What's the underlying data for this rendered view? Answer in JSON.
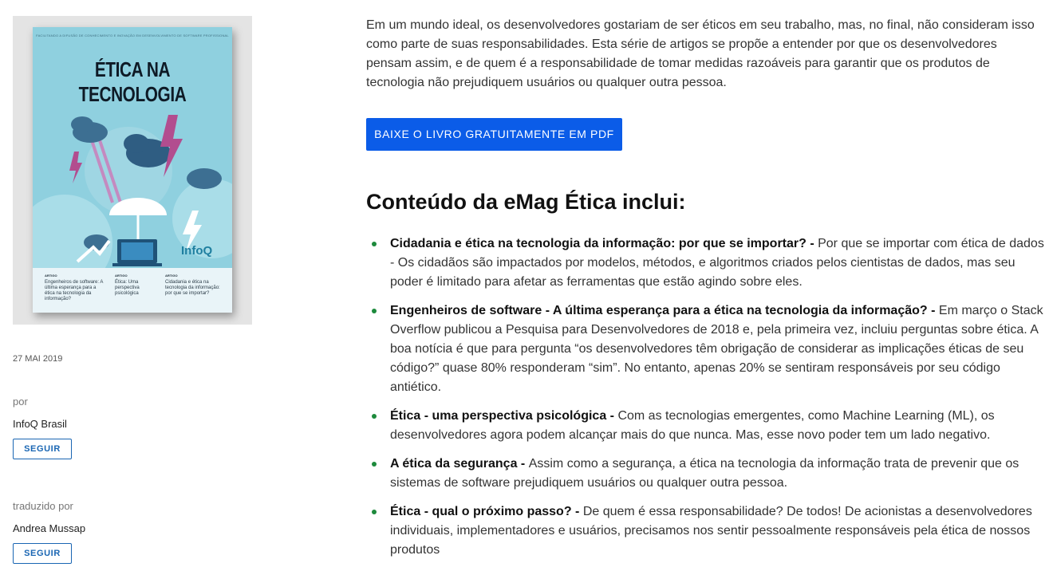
{
  "cover": {
    "top_strip": "FACILITANDO A DIFUSÃO DE CONHECIMENTO E INOVAÇÃO EM DESENVOLVIMENTO DE SOFTWARE PROFISSIONAL",
    "title": "ÉTICA NA TECNOLOGIA",
    "brand": "InfoQ",
    "articles": [
      {
        "tag": "ARTIGO",
        "text": "Engenheiros de software: A última esperança para a ética na tecnologia da informação?"
      },
      {
        "tag": "ARTIGO",
        "text": "Ética: Uma perspectiva psicológica"
      },
      {
        "tag": "ARTIGO",
        "text": "Cidadania e ética na tecnologia da informação: por que se importar?"
      }
    ]
  },
  "meta": {
    "date": "27 MAI 2019",
    "by_label": "por",
    "author": "InfoQ Brasil",
    "follow_label": "SEGUIR",
    "translated_label": "traduzido por",
    "translator": "Andrea Mussap"
  },
  "main": {
    "intro": "Em um mundo ideal, os desenvolvedores gostariam de ser éticos em seu trabalho, mas, no final, não consideram isso como parte de suas responsabilidades. Esta série de artigos se propõe a entender por que os desenvolvedores pensam assim, e de quem é a responsabilidade de tomar medidas razoáveis para garantir que os produtos de tecnologia não prejudiquem usuários ou qualquer outra pessoa.",
    "pdf_button": "BAIXE O LIVRO GRATUITAMENTE EM PDF",
    "section_title": "Conteúdo da eMag Ética inclui:",
    "items": [
      {
        "title": "Cidadania e ética na tecnologia da informação: por que se importar? - ",
        "text": "Por que se importar com ética de dados - Os cidadãos são impactados por modelos, métodos, e algoritmos criados pelos cientistas de dados, mas seu poder é limitado para afetar as ferramentas que estão agindo sobre eles."
      },
      {
        "title": "Engenheiros de software - A última esperança para a ética na tecnologia da informação? - ",
        "text": "Em março o Stack Overflow publicou a Pesquisa para Desenvolvedores de 2018 e, pela primeira vez, incluiu perguntas sobre ética. A boa notícia é que para pergunta “os desenvolvedores têm obrigação de considerar as implicações éticas de seu código?” quase 80% responderam “sim”. No entanto, apenas 20% se sentiram responsáveis por seu código antiético."
      },
      {
        "title": "Ética - uma perspectiva psicológica - ",
        "text": "Com as tecnologias emergentes, como Machine Learning (ML), os desenvolvedores agora podem alcançar mais do que nunca. Mas, esse novo poder tem um lado negativo."
      },
      {
        "title": "A ética da segurança - ",
        "text": "Assim como a segurança, a ética na tecnologia da informação trata de prevenir que os sistemas de software prejudiquem usuários ou qualquer outra pessoa."
      },
      {
        "title": "Ética - qual o próximo passo? - ",
        "text": "De quem é essa responsabilidade? De todos! De acionistas a desenvolvedores individuais, implementadores e usuários, precisamos nos sentir pessoalmente responsáveis pela ética de nossos produtos"
      }
    ]
  }
}
